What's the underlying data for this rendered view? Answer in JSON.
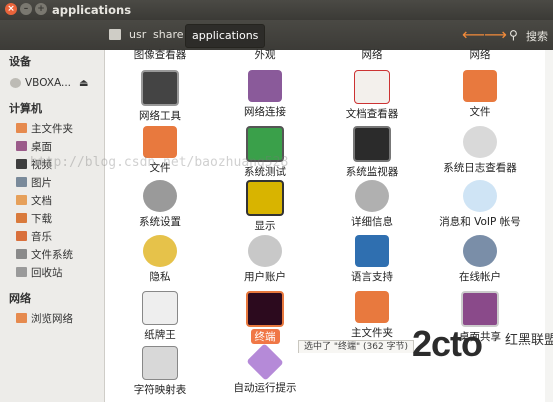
{
  "window": {
    "title": "applications"
  },
  "toolbar": {
    "crumbs": [
      "usr",
      "share"
    ],
    "active_crumb": "applications",
    "search_label": "搜索",
    "search_icon": "search-icon",
    "back_icon": "back-arrow-icon",
    "forward_icon": "forward-arrow-icon"
  },
  "sidebar": {
    "section_devices": "设备",
    "device": "VBOXA...",
    "section_computer": "计算机",
    "computer_items": [
      "主文件夹",
      "桌面",
      "视频",
      "图片",
      "文档",
      "下载",
      "音乐",
      "文件系统",
      "回收站"
    ],
    "section_network": "网络",
    "network_items": [
      "浏览网络"
    ]
  },
  "content": {
    "partial_row": [
      "图像查看器",
      "外观",
      "网络",
      "网络"
    ],
    "items": [
      "网络工具",
      "网络连接",
      "文档查看器",
      "文件",
      "文件",
      "系统测试",
      "系统监视器",
      "系统日志查看器",
      "系统设置",
      "显示",
      "详细信息",
      "消息和 VoIP 帐号",
      "隐私",
      "用户账户",
      "语言支持",
      "在线帐户",
      "纸牌王",
      "终端",
      "主文件夹",
      "桌面共享",
      "字符映射表",
      "自动运行提示"
    ],
    "selected": "终端"
  },
  "watermark": "http://blog.csdn.net/baozhuang528",
  "status_text": "选中了 \"终端\" (362 字节)",
  "brand": {
    "text": "2cto",
    "subtext": "红黑联盟"
  },
  "colors": {
    "accent": "#f07746",
    "titlebar": "#3c3b37",
    "sidebar": "#edece9"
  }
}
